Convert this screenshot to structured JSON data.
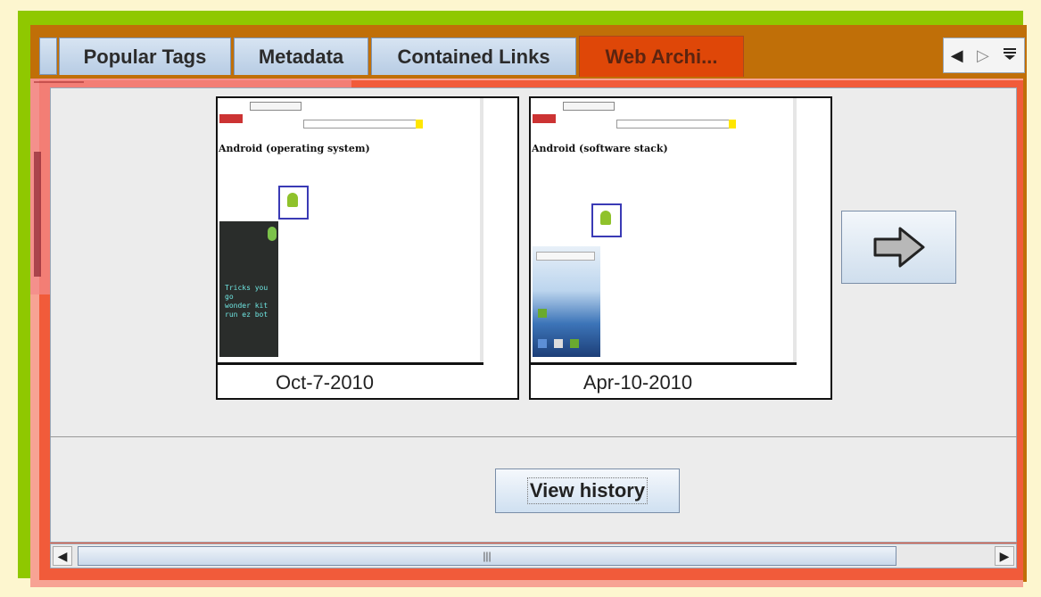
{
  "tabs": [
    {
      "label": "Popular Tags",
      "active": false
    },
    {
      "label": "Metadata",
      "active": false
    },
    {
      "label": "Contained Links",
      "active": false
    },
    {
      "label": "Web Archi...",
      "active": true
    }
  ],
  "tab_nav": {
    "left_icon": "triangle-left-icon",
    "right_icon": "triangle-right-icon",
    "menu_icon": "list-menu-icon"
  },
  "archive": {
    "snapshots": [
      {
        "date": "Oct-7-2010",
        "page_title": "Android (operating system)"
      },
      {
        "date": "Apr-10-2010",
        "page_title": "Android (software stack)"
      }
    ],
    "next_icon": "right-arrow-icon"
  },
  "actions": {
    "view_history_label": "View history"
  },
  "scrollbar": {
    "left_icon": "scroll-left-icon",
    "right_icon": "scroll-right-icon",
    "grip": "|||"
  },
  "colors": {
    "active_tab": "#df4708",
    "panel": "#ececec",
    "frame_green": "#8fc800",
    "frame_brown": "#c06f08",
    "frame_red": "#f15b3a"
  }
}
